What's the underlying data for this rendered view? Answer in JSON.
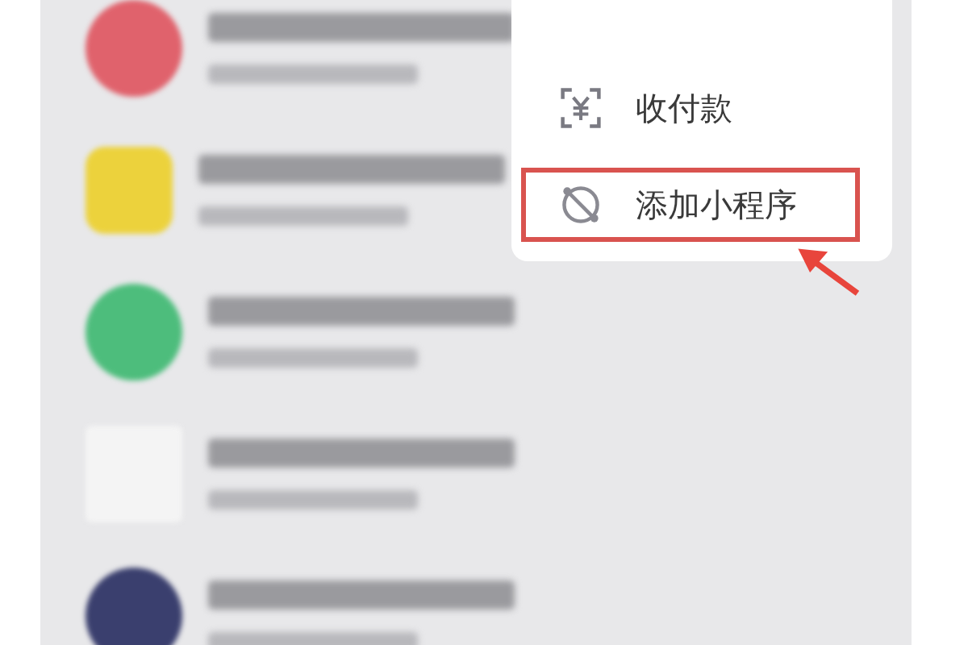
{
  "chats": [
    {
      "color": "#e0626c",
      "kind": "heart"
    },
    {
      "color": "#ecd23c",
      "kind": "tent"
    },
    {
      "color": "#4dbd7c",
      "kind": "badge"
    },
    {
      "color": "#f4f4f4",
      "kind": "logo"
    },
    {
      "color": "#3a3f6e",
      "kind": "photo"
    }
  ],
  "menu": {
    "items": [
      {
        "kind": "pay",
        "label": "收付款",
        "highlighted": false
      },
      {
        "kind": "miniprogram",
        "label": "添加小程序",
        "highlighted": true
      }
    ]
  }
}
